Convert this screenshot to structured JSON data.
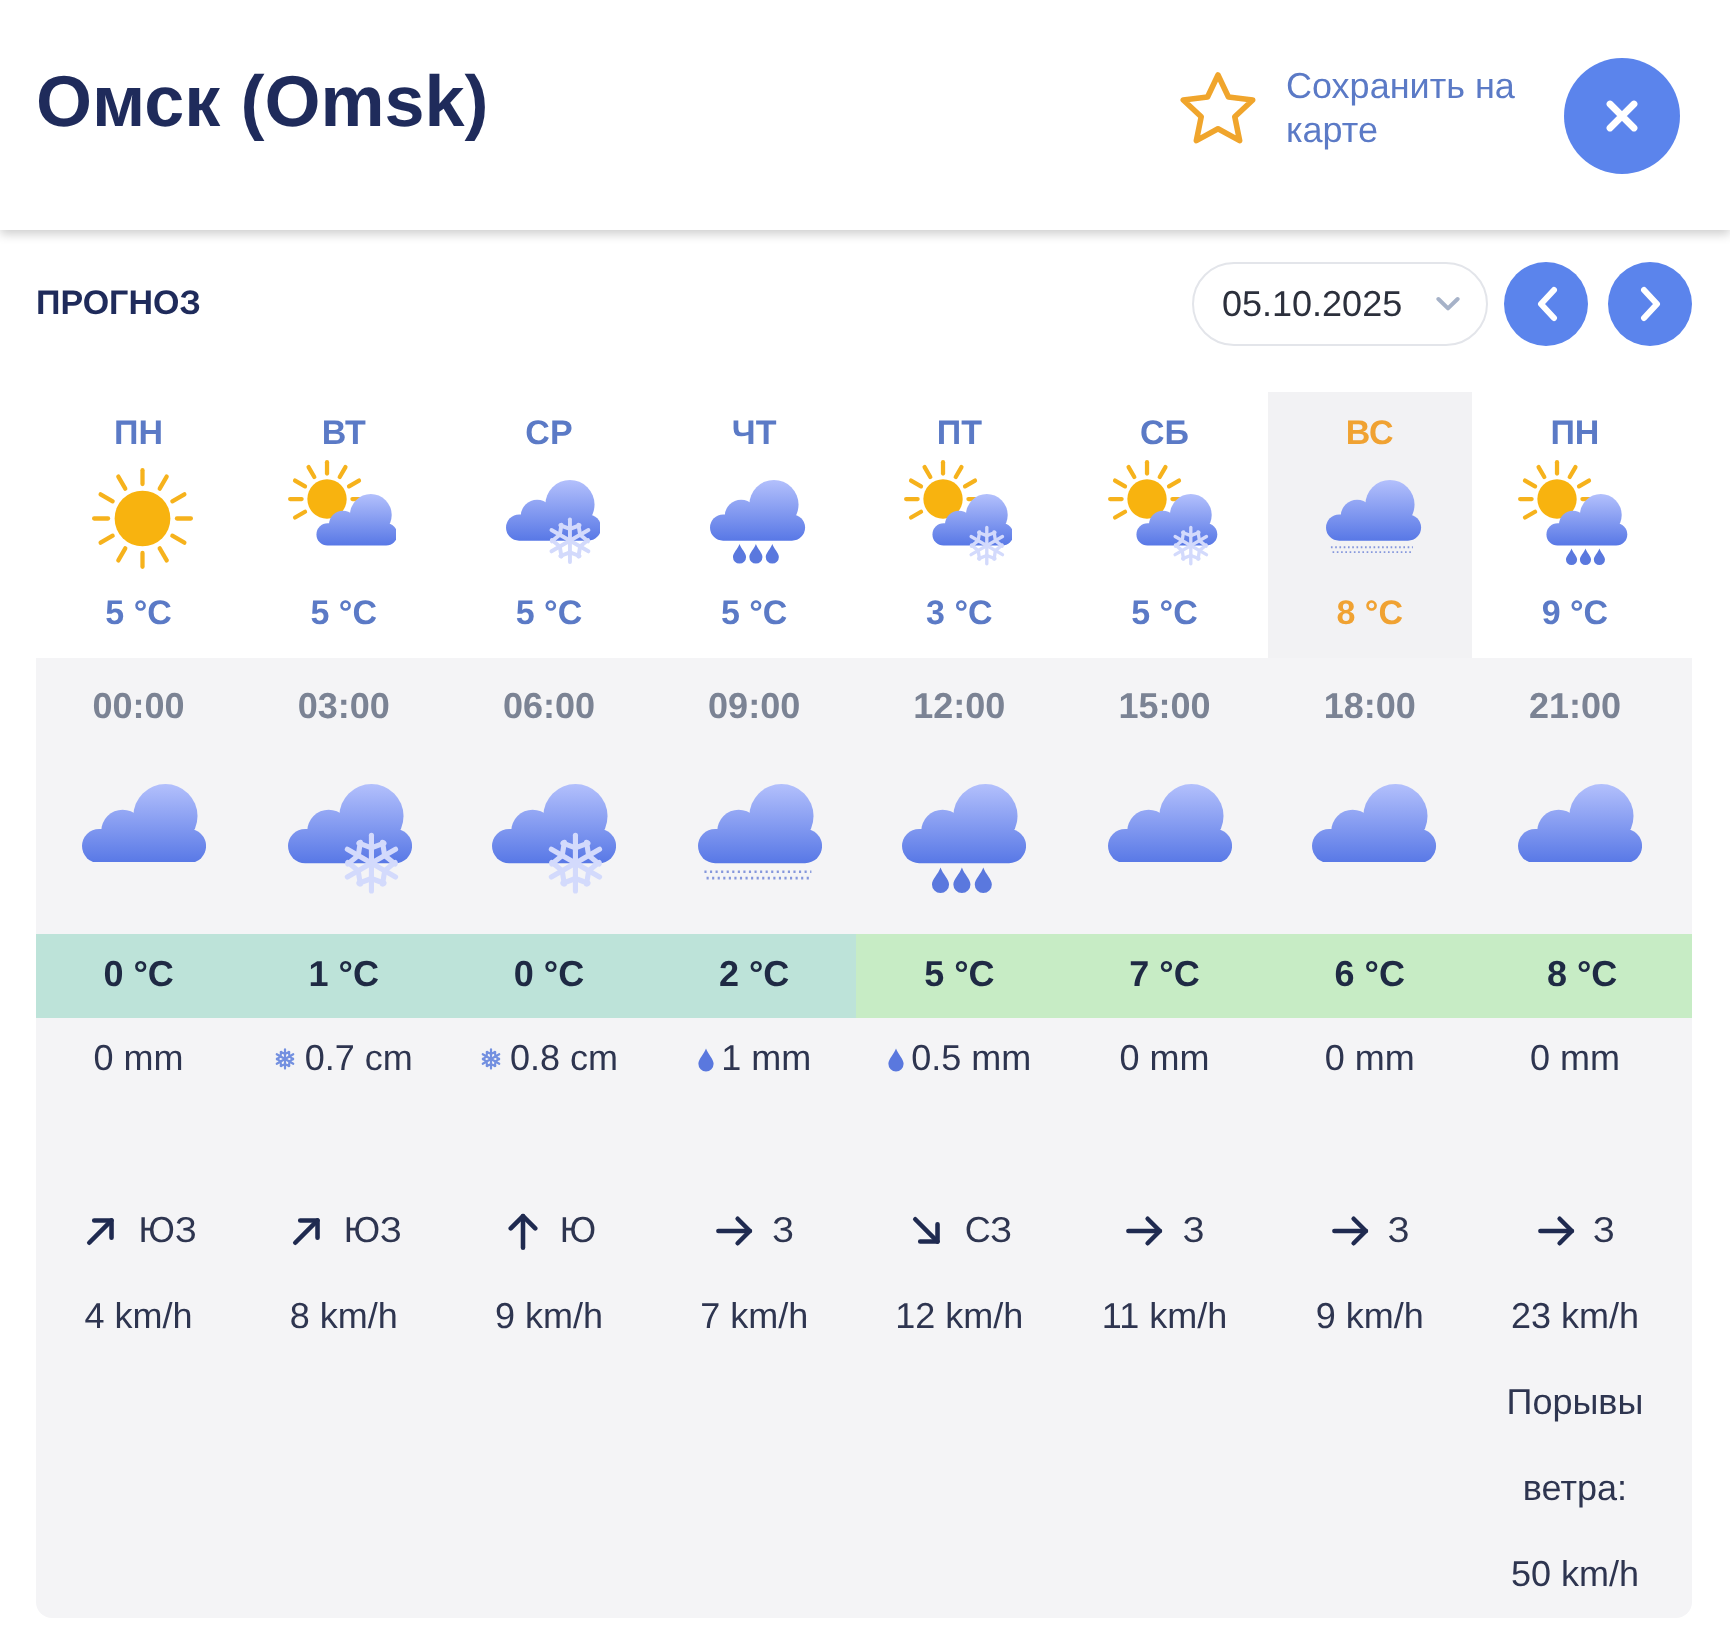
{
  "header": {
    "title": "Омск (Omsk)",
    "save_label": "Сохранить на карте"
  },
  "forecast": {
    "heading": "ПРОГНОЗ",
    "date": "05.10.2025"
  },
  "days": [
    {
      "label": "ПН",
      "kind": "sunny",
      "temp": "5 °C",
      "selected": false
    },
    {
      "label": "ВТ",
      "kind": "partly-cloudy",
      "temp": "5 °C",
      "selected": false
    },
    {
      "label": "СР",
      "kind": "snow",
      "temp": "5 °C",
      "selected": false
    },
    {
      "label": "ЧТ",
      "kind": "rain",
      "temp": "5 °C",
      "selected": false
    },
    {
      "label": "ПТ",
      "kind": "partly-cloudy-snow",
      "temp": "3 °C",
      "selected": false
    },
    {
      "label": "СБ",
      "kind": "partly-cloudy-snow",
      "temp": "5 °C",
      "selected": false
    },
    {
      "label": "ВС",
      "kind": "drizzle",
      "temp": "8 °C",
      "selected": true
    },
    {
      "label": "ПН",
      "kind": "partly-cloudy-rain",
      "temp": "9 °C",
      "selected": false
    }
  ],
  "hours": [
    {
      "time": "00:00",
      "kind": "cloudy",
      "temp": "0 °C",
      "color": "#bde3d9",
      "precip": {
        "amount": "0 mm"
      },
      "wind": {
        "kind": "northeast",
        "direction": "ЮЗ",
        "speed": "4 km/h"
      }
    },
    {
      "time": "03:00",
      "kind": "snow",
      "temp": "1 °C",
      "color": "#bde3d9",
      "precip": {
        "kind": "snow",
        "amount": "0.7 cm"
      },
      "wind": {
        "kind": "northeast",
        "direction": "ЮЗ",
        "speed": "8 km/h"
      }
    },
    {
      "time": "06:00",
      "kind": "snow",
      "temp": "0 °C",
      "color": "#bde3d9",
      "precip": {
        "kind": "snow",
        "amount": "0.8 cm"
      },
      "wind": {
        "kind": "north",
        "direction": "Ю",
        "speed": "9 km/h"
      }
    },
    {
      "time": "09:00",
      "kind": "drizzle",
      "temp": "2 °C",
      "color": "#bde3d9",
      "precip": {
        "kind": "rain",
        "amount": "1 mm"
      },
      "wind": {
        "kind": "east",
        "direction": "З",
        "speed": "7 km/h"
      }
    },
    {
      "time": "12:00",
      "kind": "rain",
      "temp": "5 °C",
      "color": "#c7ecc5",
      "precip": {
        "kind": "rain",
        "amount": "0.5 mm"
      },
      "wind": {
        "kind": "southeast",
        "direction": "СЗ",
        "speed": "12 km/h"
      }
    },
    {
      "time": "15:00",
      "kind": "cloudy",
      "temp": "7 °C",
      "color": "#c7ecc5",
      "precip": {
        "amount": "0 mm"
      },
      "wind": {
        "kind": "east",
        "direction": "З",
        "speed": "11 km/h"
      }
    },
    {
      "time": "18:00",
      "kind": "cloudy",
      "temp": "6 °C",
      "color": "#c7ecc5",
      "precip": {
        "amount": "0 mm"
      },
      "wind": {
        "kind": "east",
        "direction": "З",
        "speed": "9 km/h"
      }
    },
    {
      "time": "21:00",
      "kind": "cloudy",
      "temp": "8 °C",
      "color": "#c7ecc5",
      "precip": {
        "amount": "0 mm"
      },
      "wind": {
        "kind": "east",
        "direction": "З",
        "speed": "23 km/h"
      },
      "gust": {
        "label": "Порывы ветра:",
        "speed": "50 km/h"
      }
    }
  ]
}
